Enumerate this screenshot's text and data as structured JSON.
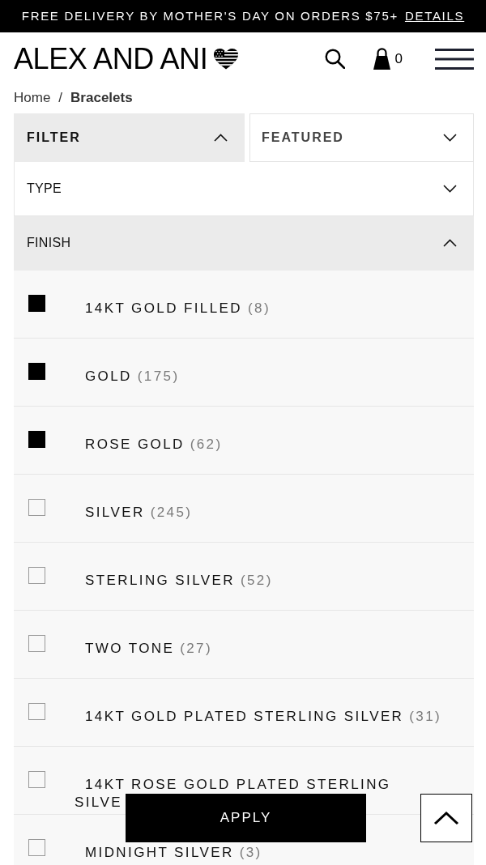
{
  "promo_banner": {
    "text": "FREE DELIVERY BY MOTHER'S DAY ON ORDERS $75+",
    "link": "DETAILS"
  },
  "header": {
    "logo": "ALEX AND ANI",
    "cart_count": "0"
  },
  "breadcrumb": {
    "separator": "/",
    "items": [
      {
        "label": "Home",
        "current": false
      },
      {
        "label": "Bracelets",
        "current": true
      }
    ]
  },
  "toolbar": {
    "filter": {
      "label": "FILTER",
      "expanded": true
    },
    "sort": {
      "label": "FEATURED",
      "expanded": false
    }
  },
  "filter_sections": [
    {
      "label": "TYPE",
      "expanded": false
    },
    {
      "label": "FINISH",
      "expanded": true,
      "options": [
        {
          "label": "14KT GOLD FILLED",
          "count": "(8)",
          "checked": true
        },
        {
          "label": "GOLD",
          "count": "(175)",
          "checked": true
        },
        {
          "label": "ROSE GOLD",
          "count": "(62)",
          "checked": true
        },
        {
          "label": "SILVER",
          "count": "(245)",
          "checked": false
        },
        {
          "label": "STERLING SILVER",
          "count": "(52)",
          "checked": false
        },
        {
          "label": "TWO TONE",
          "count": "(27)",
          "checked": false
        },
        {
          "label": "14KT GOLD PLATED STERLING SILVER",
          "count": "(31)",
          "checked": false
        },
        {
          "label": "14KT ROSE GOLD PLATED STERLING\nSILVE",
          "checked": false
        },
        {
          "label": "MIDNIGHT SILVER",
          "count": "(3)",
          "checked": false
        }
      ]
    }
  ],
  "apply_button": "APPLY"
}
